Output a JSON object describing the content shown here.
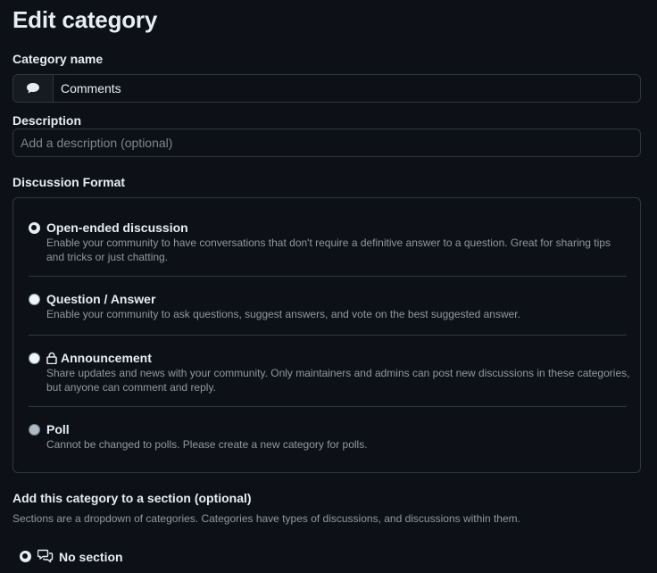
{
  "page": {
    "title": "Edit category"
  },
  "category_name": {
    "label": "Category name",
    "value": "Comments",
    "emoji_icon": "speech-bubble-icon"
  },
  "description": {
    "label": "Description",
    "placeholder": "Add a description (optional)"
  },
  "format": {
    "label": "Discussion Format",
    "options": [
      {
        "title": "Open-ended discussion",
        "desc": "Enable your community to have conversations that don't require a definitive answer to a question. Great for sharing tips and tricks or just chatting.",
        "selected": true
      },
      {
        "title": "Question / Answer",
        "desc": "Enable your community to ask questions, suggest answers, and vote on the best suggested answer.",
        "selected": false
      },
      {
        "title": "Announcement",
        "desc": "Share updates and news with your community. Only maintainers and admins can post new discussions in these categories, but anyone can comment and reply.",
        "selected": false,
        "icon": "lock-icon"
      },
      {
        "title": "Poll",
        "desc": "Cannot be changed to polls. Please create a new category for polls.",
        "selected": false,
        "disabled": true
      }
    ]
  },
  "section": {
    "label": "Add this category to a section (optional)",
    "desc": "Sections are a dropdown of categories. Categories have types of discussions, and discussions within them.",
    "options": [
      {
        "title": "No section",
        "selected": true,
        "icon": "discussions-icon"
      }
    ]
  }
}
